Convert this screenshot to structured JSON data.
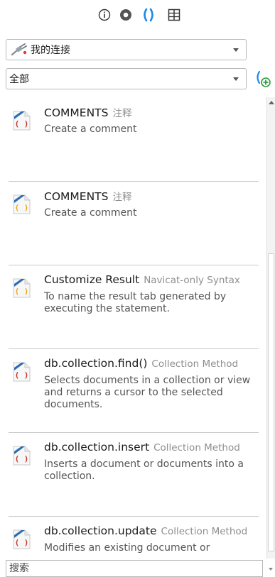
{
  "toolbar": {
    "icons": [
      "info-icon",
      "eye-icon",
      "code-snippet-icon",
      "columns-icon"
    ],
    "active_color": "#1e88e5"
  },
  "connection_dropdown": {
    "value": "我的连接"
  },
  "category_dropdown": {
    "value": "全部"
  },
  "snippets": [
    {
      "title": "COMMENTS",
      "subtitle": "注释",
      "description": "Create a comment",
      "icon_tint": "#c0392b"
    },
    {
      "title": "COMMENTS",
      "subtitle": "注释",
      "description": "Create a comment",
      "icon_tint": "#e6a817"
    },
    {
      "title": "Customize Result",
      "subtitle": "Navicat-only Syntax",
      "description": "To name the result tab generated by executing the statement.",
      "icon_tint": "#e6a817"
    },
    {
      "title": "db.collection.find()",
      "subtitle": "Collection Method",
      "description": "Selects documents in a collection or view and returns a cursor to the selected documents.",
      "icon_tint": "#c0392b"
    },
    {
      "title": "db.collection.insert",
      "subtitle": "Collection Method",
      "description": "Inserts a document or documents into a collection.",
      "icon_tint": "#c0392b"
    },
    {
      "title": "db.collection.update",
      "subtitle": "Collection Method",
      "description": "Modifies an existing document or",
      "icon_tint": "#c0392b"
    }
  ],
  "search": {
    "placeholder": "搜索"
  }
}
